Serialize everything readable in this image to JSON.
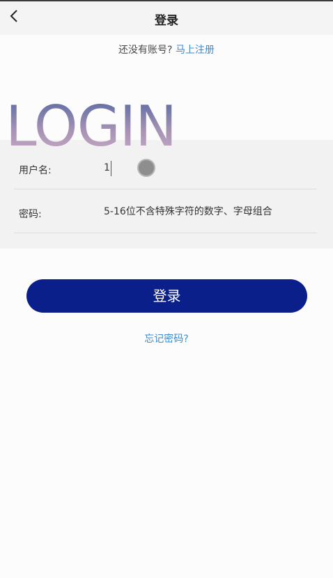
{
  "header": {
    "title": "登录",
    "back_icon": "chevron-left-icon"
  },
  "register": {
    "prompt": "还没有账号?",
    "link": "马上注册"
  },
  "banner": {
    "text": "LOGIN"
  },
  "form": {
    "username_label": "用户名:",
    "username_value": "1",
    "password_label": "密码:",
    "password_placeholder": "5-16位不含特殊字符的数字、字母组合"
  },
  "actions": {
    "login_label": "登录",
    "forgot_label": "忘记密码?"
  },
  "colors": {
    "primary_button": "#0b1f8a",
    "link": "#3a8ad0"
  }
}
